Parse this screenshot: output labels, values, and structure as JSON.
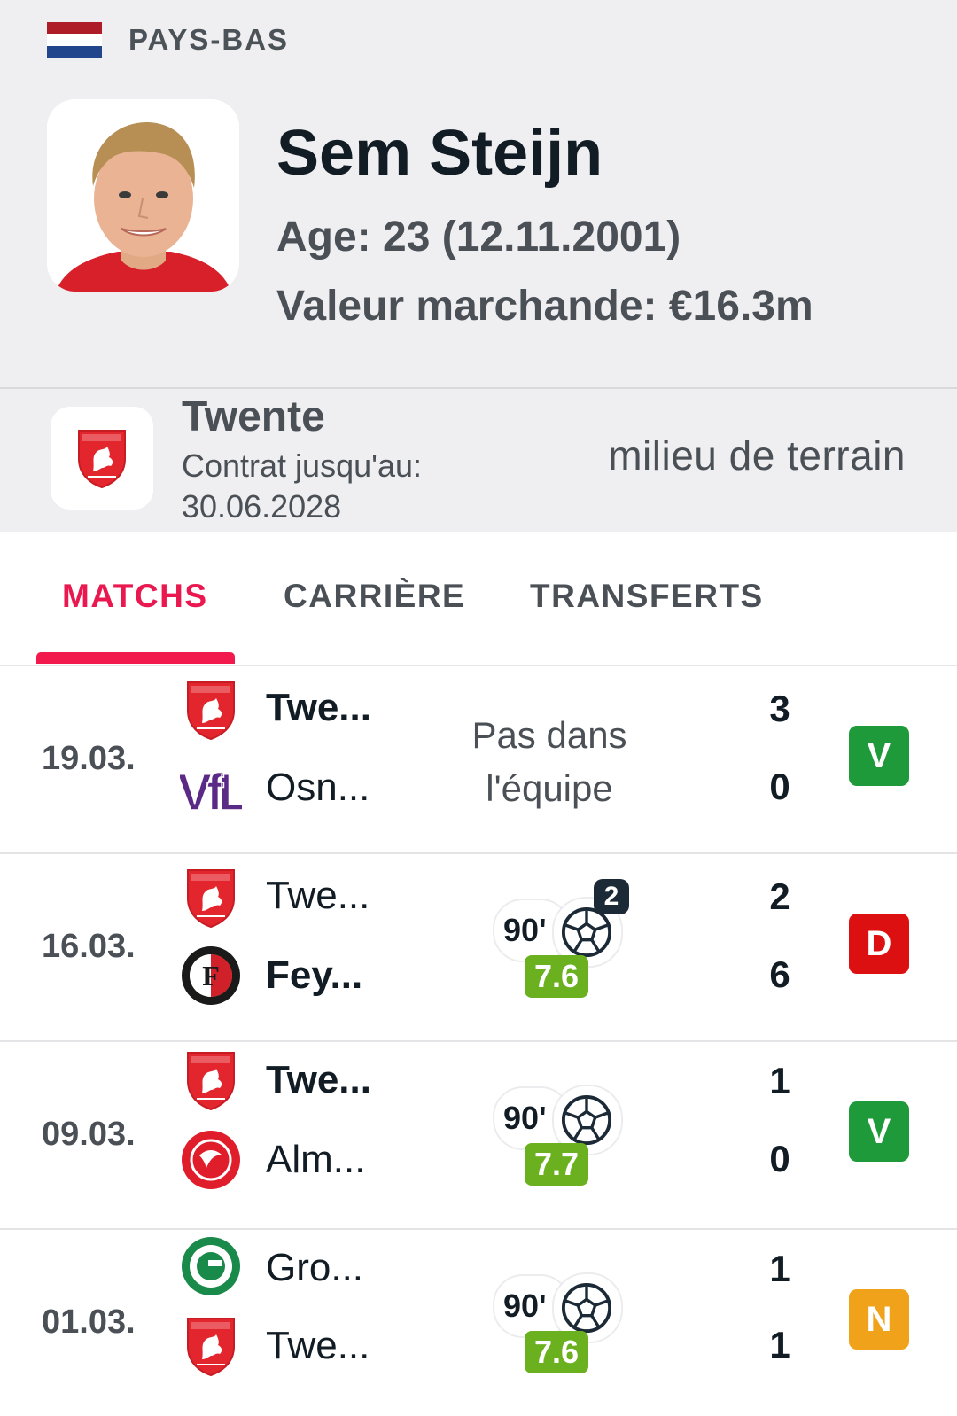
{
  "header": {
    "country": "PAYS-BAS",
    "flag_colors": [
      "#ae1c28",
      "#ffffff",
      "#21468b"
    ],
    "player_name": "Sem Steijn",
    "age": "Age: 23 (12.11.2001)",
    "market_value": "Valeur marchande: €16.3m"
  },
  "club": {
    "name": "Twente",
    "contract_label": "Contrat jusqu'au:",
    "contract_date": "30.06.2028",
    "position": "milieu de terrain"
  },
  "tabs": [
    {
      "label": "MATCHS",
      "active": true
    },
    {
      "label": "CARRIÈRE",
      "active": false
    },
    {
      "label": "TRANSFERTS",
      "active": false
    }
  ],
  "matches": [
    {
      "date": "19.03.",
      "home": {
        "name": "Twe...",
        "logo": "twente-logo",
        "winner": true
      },
      "away": {
        "name": "Osn...",
        "logo": "vfl-osnabrueck-logo",
        "winner": false
      },
      "home_score": "3",
      "away_score": "0",
      "status": "Pas dans l'équipe",
      "result": "V",
      "result_color": "#1e9a3a"
    },
    {
      "date": "16.03.",
      "home": {
        "name": "Twe...",
        "logo": "twente-logo",
        "winner": false
      },
      "away": {
        "name": "Fey...",
        "logo": "feyenoord-logo",
        "winner": true
      },
      "home_score": "2",
      "away_score": "6",
      "minutes": "90'",
      "goals": "2",
      "rating": "7.6",
      "result": "D",
      "result_color": "#dc1010"
    },
    {
      "date": "09.03.",
      "home": {
        "name": "Twe...",
        "logo": "twente-logo",
        "winner": true
      },
      "away": {
        "name": "Alm...",
        "logo": "almere-city-logo",
        "winner": false
      },
      "home_score": "1",
      "away_score": "0",
      "minutes": "90'",
      "rating": "7.7",
      "result": "V",
      "result_color": "#1e9a3a"
    },
    {
      "date": "01.03.",
      "home": {
        "name": "Gro...",
        "logo": "groningen-logo",
        "winner": false
      },
      "away": {
        "name": "Twe...",
        "logo": "twente-logo",
        "winner": false
      },
      "home_score": "1",
      "away_score": "1",
      "minutes": "90'",
      "rating": "7.6",
      "result": "N",
      "result_color": "#f0a21b"
    }
  ]
}
